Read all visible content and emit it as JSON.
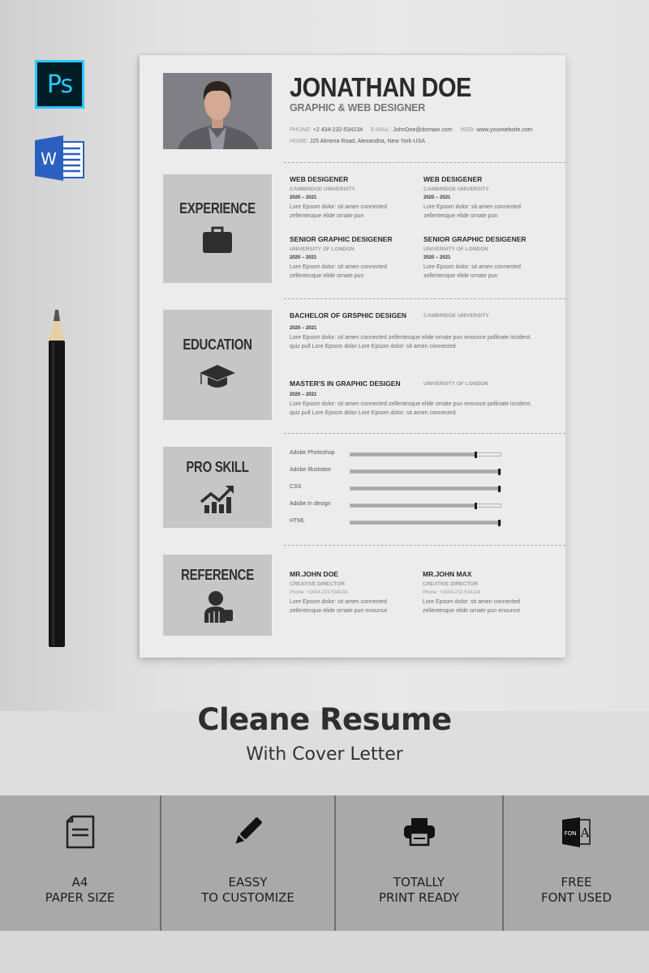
{
  "app_icons": [
    {
      "name": "photoshop",
      "label": "Ps",
      "color": "#26c9ff",
      "bg": "#001d26"
    },
    {
      "name": "word",
      "label": "W",
      "color": "#2b5fc0"
    }
  ],
  "resume": {
    "name": "JONATHAN DOE",
    "role": "GRAPHIC & WEB DESIGNER",
    "contact": {
      "phone_label": "PHONE:",
      "phone": "+2 434-232-534234",
      "email_label": "E-MAIL:",
      "email": "JohnDoe@domain.com",
      "web_label": "WEB:",
      "web": "www.yourwebsite.com",
      "home_label": "HOME:",
      "home": "J25 Almeria Road, Alexandria, New York-USA"
    },
    "sections": {
      "experience": "EXPERIENCE",
      "education": "EDUCATION",
      "skills": "PRO SKILL",
      "reference": "REFERENCE"
    },
    "experience": [
      {
        "title": "WEB DESIGENER",
        "org": "CAMBRIDGE UNIVERSITY",
        "years": "2020 – 2021",
        "desc": "Lore Epsom dolor: sit amen connected zellentesque elide ornate pun"
      },
      {
        "title": "WEB DESIGENER",
        "org": "CAMBRIDGE UNIVERSITY",
        "years": "2020 – 2021",
        "desc": "Lore Epsom dolor: sit amen connected zellentesque elide ornate pun"
      },
      {
        "title": "SENIOR GRAPHIC DESIGENER",
        "org": "UNIVERSITY OF LONDON",
        "years": "2020 – 2021",
        "desc": "Lore Epsom dolor: sit amen connected zellentesque elide ornate pun"
      },
      {
        "title": "SENIOR GRAPHIC DESIGENER",
        "org": "UNIVERSITY OF LONDON",
        "years": "2020 – 2021",
        "desc": "Lore Epsom dolor: sit amen connected zellentesque elide ornate pun"
      }
    ],
    "education": [
      {
        "title": "BACHELOR OF GRSPHIC DESIGEN",
        "org": "CAMBRIDGE UNIVERSITY",
        "years": "2020 – 2021",
        "desc": "Lore Epsom dolor: sit amen connected zellentesque elide ornate pun enounce pollinate incident. quiz pull Lore Epsom dolor Lore Epsom dolor: sit amen connected"
      },
      {
        "title": "MASTER'S IN GRAPHIC DESIGEN",
        "org": "UNIVERSITY OF LONDON",
        "years": "2020 – 2021",
        "desc": "Lore Epsom dolor: sit amen connected zellentesque elide ornate pun enounce pollinate incident. quiz pull Lore Epsom dolor Lore Epsom dolor: sit amen connected"
      }
    ],
    "skills": [
      {
        "name": "Adobe Photoshop",
        "level": 0.84
      },
      {
        "name": "Adobe Illustrator",
        "level": 1.0
      },
      {
        "name": "CSS",
        "level": 1.0
      },
      {
        "name": "Adobe In design",
        "level": 0.84
      },
      {
        "name": "HTML",
        "level": 1.0
      }
    ],
    "references": [
      {
        "name": "MR.JOHN DOE",
        "title": "CREATIVE DIRECTOR",
        "phone": "Phone :+2434-232-534134",
        "desc": "Lore Epsom dolor: sit amen connected zellentesque elide ornate pun enounce"
      },
      {
        "name": "MR.JOHN MAX",
        "title": "CREATIVE DIRECTOR",
        "phone": "Phone :+2434-232-534134",
        "desc": "Lore Epsom dolor: sit amen connected zellentesque elide ornate pun enounce"
      }
    ]
  },
  "product": {
    "title": "Cleane Resume",
    "subtitle": "With Cover Letter"
  },
  "features": [
    {
      "icon": "document-icon",
      "line1": "A4",
      "line2": "PAPER SIZE"
    },
    {
      "icon": "pencil-icon",
      "line1": "EASSY",
      "line2": "TO CUSTOMIZE"
    },
    {
      "icon": "printer-icon",
      "line1": "TOTALLY",
      "line2": "PRINT READY"
    },
    {
      "icon": "font-icon",
      "line1": "FREE",
      "line2": "FONT USED",
      "icon_text": "FON",
      "icon_letter": "A"
    }
  ]
}
